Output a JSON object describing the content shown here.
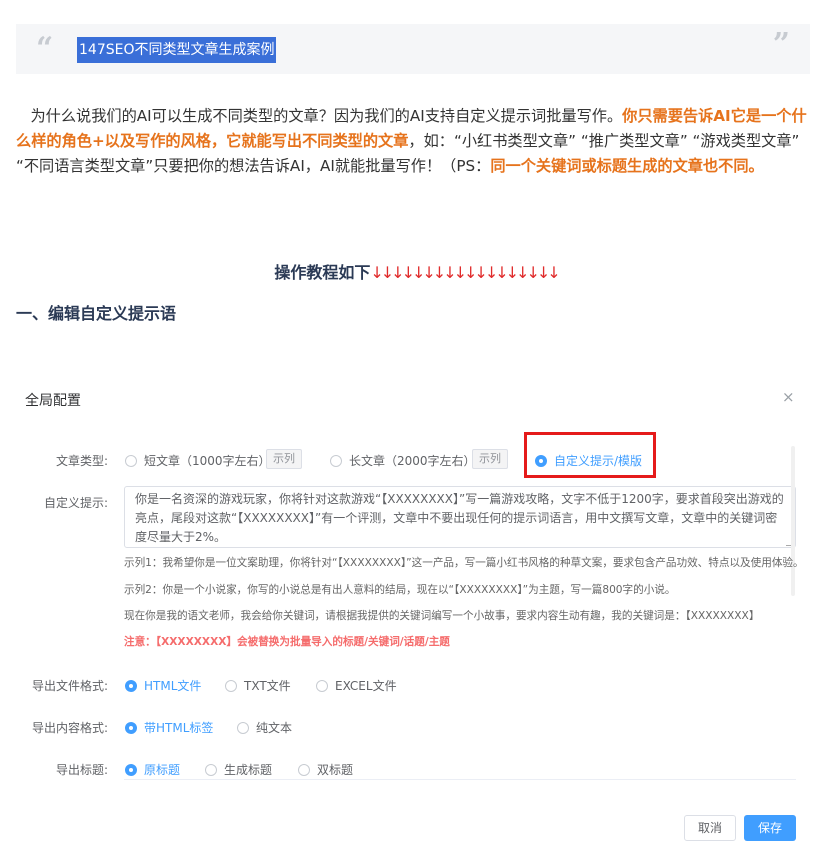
{
  "article": {
    "quote_title": "147SEO不同类型文章生成案例",
    "intro_1": "为什么说我们的AI可以生成不同类型的文章？因为我们的AI支持自定义提示词批量写作。",
    "intro_hl_1": "你只需要告诉AI它是一个什么样的角色+以及写作的风格，它就能写出不同类型的文章",
    "intro_2": "，如：“小红书类型文章” “推广类型文章” “游戏类型文章” “不同语言类型文章”只要把你的想法告诉AI，AI就能批量写作！（PS：",
    "intro_hl_2": "同一个关键词或标题生成的文章也不同。",
    "tutorial_heading": "操作教程如下",
    "tutorial_arrows": "↓↓↓↓↓↓↓↓↓↓↓↓↓↓↓↓↓↓",
    "section_1": "一、编辑自定义提示语"
  },
  "dialog": {
    "title": "全局配置",
    "close_glyph": "×",
    "article_type_label": "文章类型:",
    "short_option": "短文章（1000字左右）",
    "long_option": "长文章（2000字左右）",
    "example_btn": "示列",
    "custom_option": "自定义提示/模版",
    "custom_prompt_label": "自定义提示:",
    "custom_prompt_value": "你是一名资深的游戏玩家，你将针对这款游戏“【XXXXXXXX】”写一篇游戏攻略，文字不低于1200字，要求首段突出游戏的亮点，尾段对这款“【XXXXXXXX】”有一个评测，文章中不要出现任何的提示词语言，用中文撰写文章，文章中的关键词密度尽量大于2%。",
    "example_1": "示列1：我希望你是一位文案助理，你将针对“【XXXXXXXX】”这一产品，写一篇小红书风格的种草文案，要求包含产品功效、特点以及使用体验。",
    "example_2": "示列2：你是一个小说家，你写的小说总是有出人意料的结局，现在以“【XXXXXXXX】”为主题，写一篇800字的小说。",
    "example_3": "现在你是我的语文老师，我会给你关键词，请根据我提供的关键词编写一个小故事，要求内容生动有趣，我的关键词是：【XXXXXXXX】",
    "note": "注意：【XXXXXXXX】会被替换为批量导入的标题/关键词/话题/主题",
    "export_format_label": "导出文件格式:",
    "export_format_options": [
      "HTML文件",
      "TXT文件",
      "EXCEL文件"
    ],
    "export_content_label": "导出内容格式:",
    "export_content_options": [
      "带HTML标签",
      "纯文本"
    ],
    "export_title_label": "导出标题:",
    "export_title_options": [
      "原标题",
      "生成标题",
      "双标题"
    ],
    "cancel": "取消",
    "save": "保存"
  },
  "colors": {
    "accent": "#409eff",
    "highlight_orange": "#e6731c",
    "annotation_red": "#e51b1b",
    "note_red": "#f56c6c"
  }
}
